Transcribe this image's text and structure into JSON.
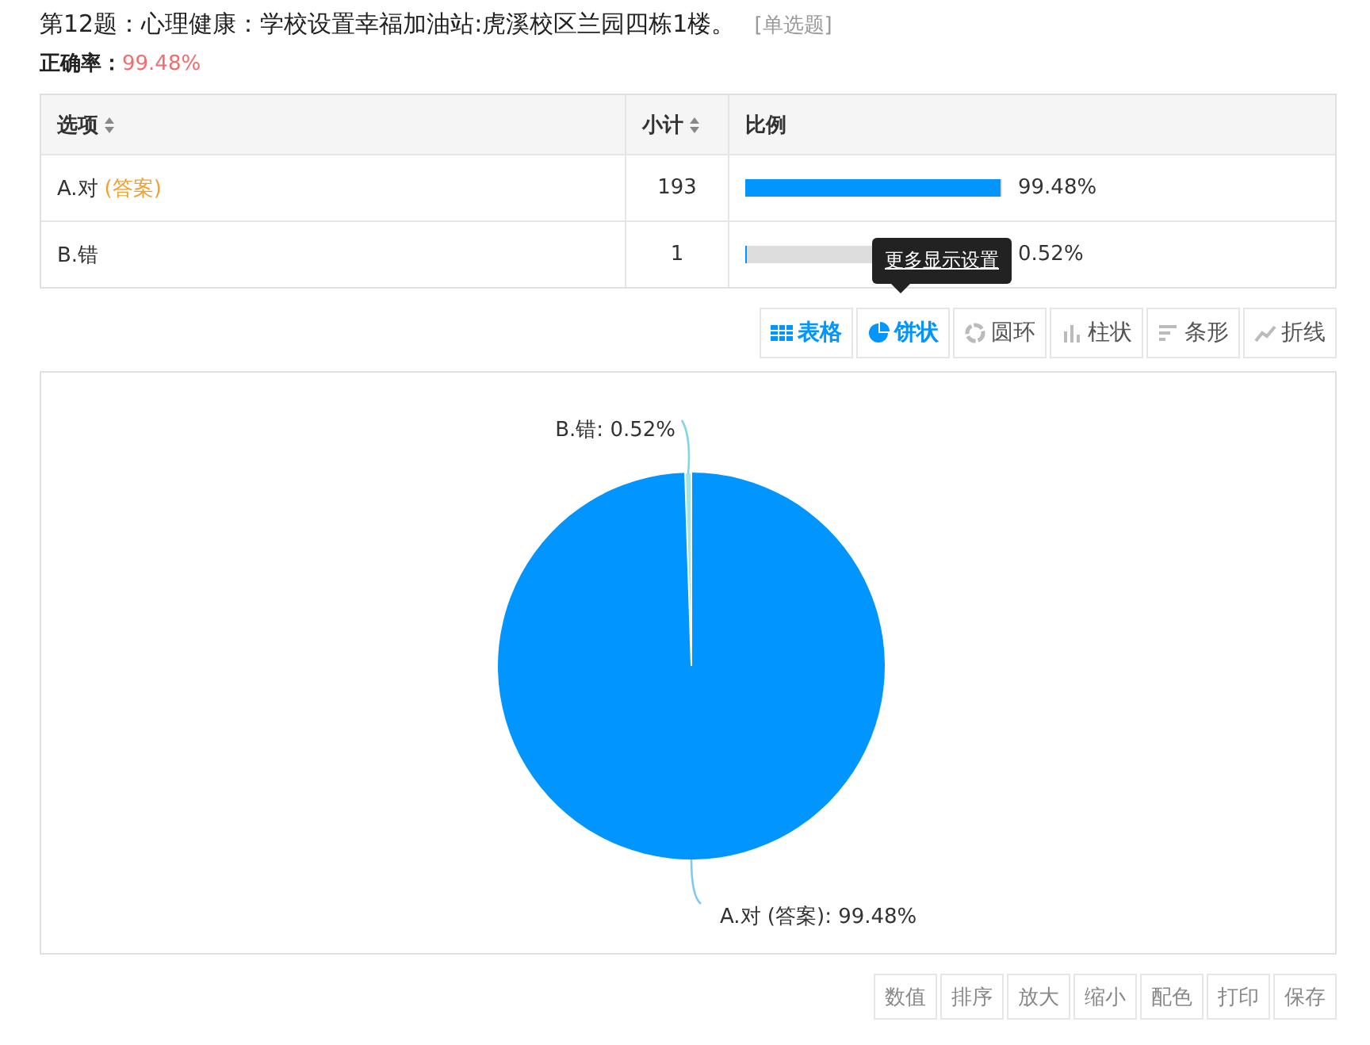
{
  "question": {
    "title": "第12题：心理健康：学校设置幸福加油站:虎溪校区兰园四栋1楼。",
    "type": "[单选题]"
  },
  "accuracy": {
    "label": "正确率：",
    "value": "99.48%"
  },
  "table": {
    "columns": [
      {
        "label": "选项",
        "sortable": true
      },
      {
        "label": "小计",
        "sortable": true
      },
      {
        "label": "比例",
        "sortable": false
      }
    ],
    "rows": [
      {
        "option": "A.对",
        "answer_tag": "(答案)",
        "count": "193",
        "level": 0.9948,
        "percent": "99.48%"
      },
      {
        "option": "B.错",
        "count": "1",
        "level": 0.0052,
        "percent": "0.52%"
      }
    ]
  },
  "tooltip": "更多显示设置",
  "view_buttons": [
    {
      "kind": "table",
      "label": "表格",
      "selected": true
    },
    {
      "kind": "pie",
      "label": "饼状",
      "selected": true
    },
    {
      "kind": "ring",
      "label": "圆环",
      "selected": false
    },
    {
      "kind": "column",
      "label": "柱状",
      "selected": false
    },
    {
      "kind": "bar",
      "label": "条形",
      "selected": false
    },
    {
      "kind": "line",
      "label": "折线",
      "selected": false
    }
  ],
  "chart_data": {
    "type": "pie",
    "categories": [
      "A.对 (答案): 99.48%",
      "B.错: 0.52%"
    ],
    "series": [
      {
        "values": [
          99.48,
          0.52
        ]
      }
    ]
  },
  "tools": [
    "数值",
    "排序",
    "放大",
    "缩小",
    "配色",
    "打印",
    "保存"
  ]
}
